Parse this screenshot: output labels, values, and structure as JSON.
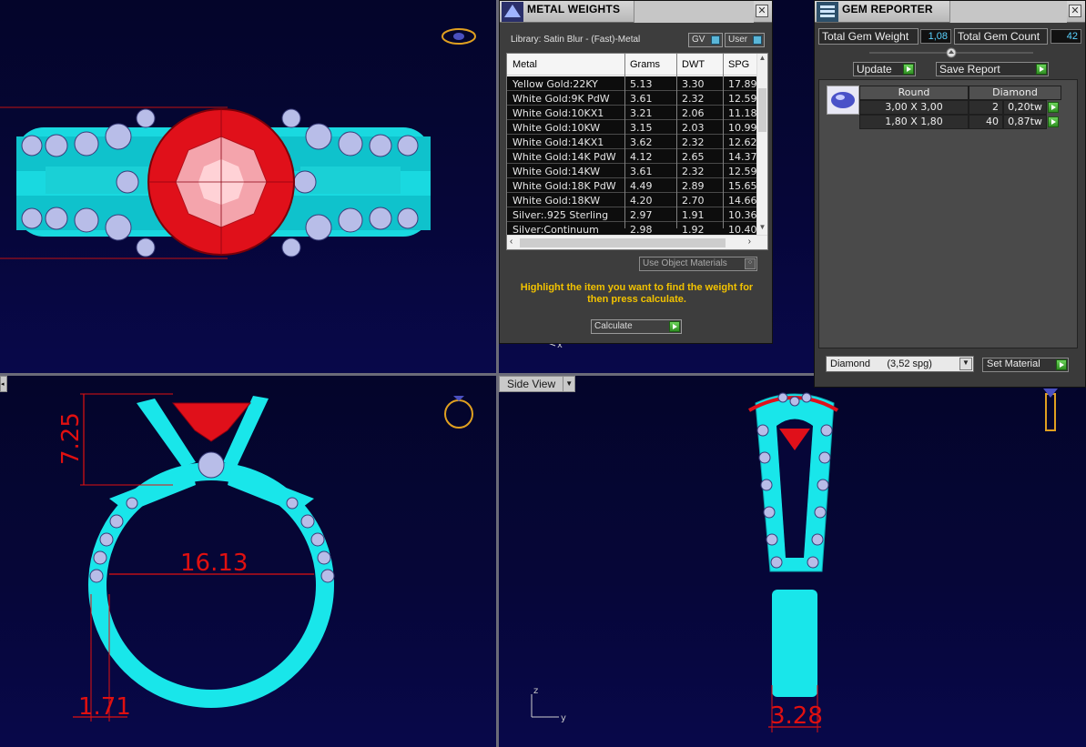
{
  "viewports": {
    "bottom_right_tab": "Side View"
  },
  "dimensions": {
    "bottom_left_height": "7.25",
    "bottom_left_diameter": "16.13",
    "bottom_left_band": "1.71",
    "bottom_right_width": "3.28"
  },
  "axis": {
    "z": "z",
    "y": "y",
    "x": "x"
  },
  "metal_weights": {
    "title": "METAL WEIGHTS",
    "library": "Library: Satin Blur - (Fast)-Metal",
    "gv_label": "GV",
    "user_label": "User",
    "columns": [
      "Metal",
      "Grams",
      "DWT",
      "SPG"
    ],
    "rows": [
      {
        "metal": "Yellow Gold:22KY",
        "grams": "5.13",
        "dwt": "3.30",
        "spg": "17.89"
      },
      {
        "metal": "White Gold:9K PdW",
        "grams": "3.61",
        "dwt": "2.32",
        "spg": "12.59"
      },
      {
        "metal": "White Gold:10KX1",
        "grams": "3.21",
        "dwt": "2.06",
        "spg": "11.18"
      },
      {
        "metal": "White Gold:10KW",
        "grams": "3.15",
        "dwt": "2.03",
        "spg": "10.99"
      },
      {
        "metal": "White Gold:14KX1",
        "grams": "3.62",
        "dwt": "2.32",
        "spg": "12.62"
      },
      {
        "metal": "White Gold:14K PdW",
        "grams": "4.12",
        "dwt": "2.65",
        "spg": "14.37"
      },
      {
        "metal": "White Gold:14KW",
        "grams": "3.61",
        "dwt": "2.32",
        "spg": "12.59"
      },
      {
        "metal": "White Gold:18K PdW",
        "grams": "4.49",
        "dwt": "2.89",
        "spg": "15.65"
      },
      {
        "metal": "White Gold:18KW",
        "grams": "4.20",
        "dwt": "2.70",
        "spg": "14.66"
      },
      {
        "metal": "Silver:.925 Sterling",
        "grams": "2.97",
        "dwt": "1.91",
        "spg": "10.36"
      },
      {
        "metal": "Silver:Continuum",
        "grams": "2.98",
        "dwt": "1.92",
        "spg": "10.40"
      }
    ],
    "use_object_materials": "Use Object Materials",
    "hint": "Highlight the item you want to find the weight for then press calculate.",
    "calculate": "Calculate"
  },
  "gem_reporter": {
    "title": "GEM REPORTER",
    "total_gem_weight_label": "Total Gem Weight",
    "total_gem_weight": "1,08",
    "total_gem_count_label": "Total Gem Count",
    "total_gem_count": "42",
    "update": "Update",
    "save_report": "Save Report",
    "shape_header": "Round",
    "material_header": "Diamond",
    "rows": [
      {
        "size": "3,00 X 3,00",
        "count": "2",
        "weight": "0,20tw"
      },
      {
        "size": "1,80 X 1,80",
        "count": "40",
        "weight": "0,87tw"
      }
    ],
    "material_select": "Diamond      (3,52 spg)",
    "set_material": "Set Material"
  },
  "colors": {
    "viewport_bg": "#060638",
    "metal_cyan": "#19e6ea",
    "ruby_red": "#e0101a",
    "dimension_red": "#e01010",
    "hint_yellow": "#f2c200",
    "value_cyan": "#5ad3ff"
  }
}
